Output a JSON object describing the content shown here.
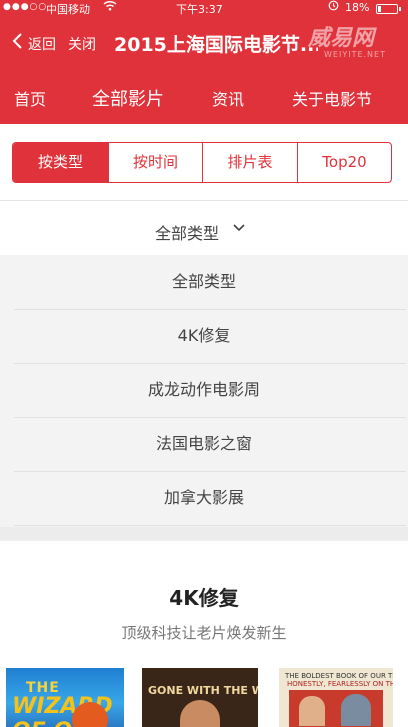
{
  "status_bar": {
    "signal": "●●●○○",
    "carrier": "中国移动",
    "time": "下午3:37",
    "battery": "18%"
  },
  "header": {
    "back_label": "返回",
    "close_label": "关闭",
    "title": "2015上海国际电影节...",
    "watermark_main": "威易网",
    "watermark_sub": "WEIYITE.NET"
  },
  "main_nav": {
    "items": [
      "首页",
      "全部影片",
      "资讯",
      "关于电影节"
    ],
    "active_index": 1
  },
  "segments": {
    "items": [
      "按类型",
      "按时间",
      "排片表",
      "Top20"
    ],
    "active_index": 0
  },
  "type_filter": {
    "selected": "全部类型",
    "options": [
      "全部类型",
      "4K修复",
      "成龙动作电影周",
      "法国电影之窗",
      "加拿大影展"
    ]
  },
  "section": {
    "title": "4K修复",
    "subtitle": "顶级科技让老片焕发新生"
  },
  "posters": [
    {
      "title_top": "THE",
      "title_main": "WIZARD OF OZ"
    },
    {
      "title_main": "GONE WITH THE WIND"
    },
    {
      "title_top": "THE BOLDEST BOOK OF OUR TIME...",
      "title_main": "HONESTLY, FEARLESSLY ON THE SCREEN!"
    }
  ],
  "colors": {
    "brand_red": "#e0323a",
    "list_bg": "#f3f3f3"
  }
}
